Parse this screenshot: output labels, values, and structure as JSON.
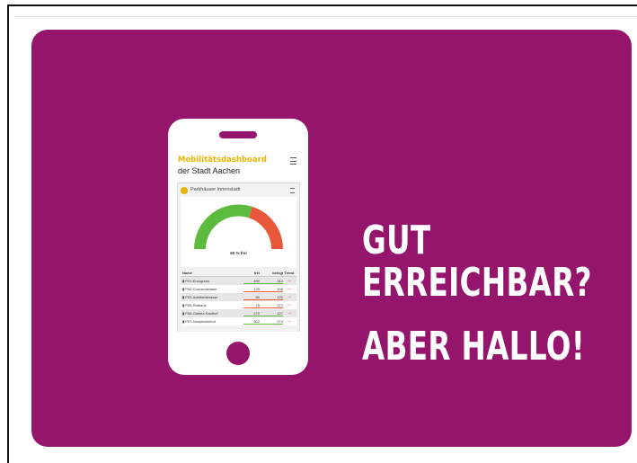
{
  "headline": {
    "line1": "GUT",
    "line2": "ERREICHBAR?",
    "line3": "ABER HALLO!"
  },
  "phone_screen": {
    "app_title": "Mobilitätsdashboard",
    "app_subtitle": "der Stadt Aachen",
    "panel_title": "Parkhäuser Innenstadt",
    "gauge_label": "60 % frei",
    "gauge_free_fraction": 0.6,
    "table": {
      "headers": {
        "name": "Name",
        "free": "frei",
        "used": "belegt",
        "trend": "Trend"
      },
      "rows": [
        {
          "name": "P01-Eurogress",
          "free": "490",
          "used": "314",
          "bar": "green"
        },
        {
          "name": "P02-Couvenstrasse",
          "free": "125",
          "used": "408",
          "bar": "red"
        },
        {
          "name": "P03-Adalbertstrasse",
          "free": "60",
          "used": "122",
          "bar": "red"
        },
        {
          "name": "P05-Rathaus",
          "free": "75",
          "used": "271",
          "bar": "red"
        },
        {
          "name": "P06-Galeria Kaufhof",
          "free": "272",
          "used": "427",
          "bar": "green"
        },
        {
          "name": "P07-Hauptbahnhof",
          "free": "302",
          "used": "274",
          "bar": "green"
        }
      ],
      "trend_symbol": "→"
    }
  },
  "colors": {
    "brand_purple": "#95156c",
    "accent_yellow": "#e8b400",
    "gauge_green": "#5cba3c",
    "gauge_red": "#e8573a"
  },
  "icons": {
    "menu": "hamburger-icon",
    "parking": "parking-icon",
    "trend": "arrow-right-icon"
  }
}
